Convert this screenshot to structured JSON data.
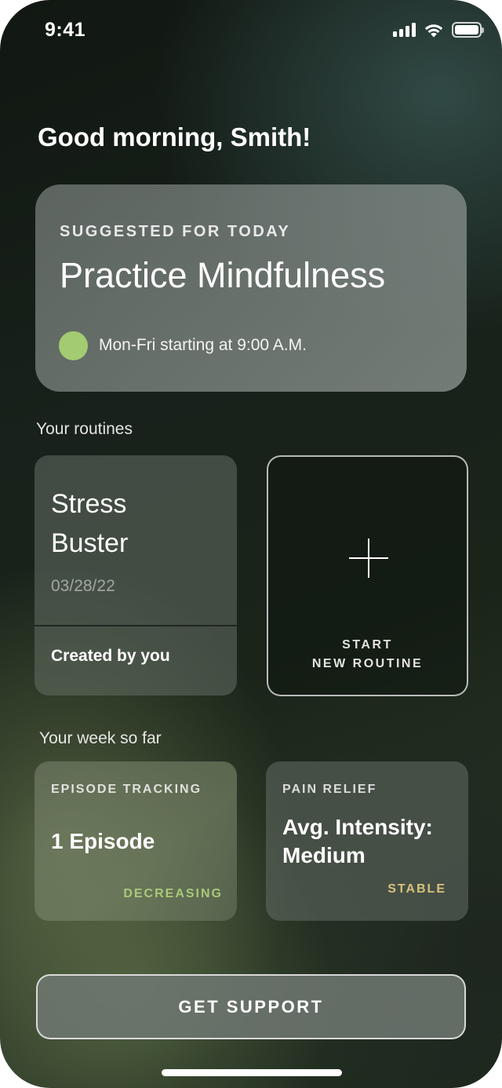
{
  "status_bar": {
    "time": "9:41",
    "icons": [
      "cellular-signal-icon",
      "wifi-icon",
      "battery-icon"
    ]
  },
  "greeting": "Good morning, Smith!",
  "suggested": {
    "eyebrow": "SUGGESTED FOR TODAY",
    "title": "Practice Mindfulness",
    "schedule": "Mon-Fri starting at 9:00 A.M.",
    "dot_color": "#a3cc72"
  },
  "routines": {
    "label": "Your routines",
    "items": [
      {
        "name": "Stress Buster",
        "date": "03/28/22",
        "footer": "Created by you"
      }
    ],
    "new_routine": {
      "label": "START\nNEW ROUTINE",
      "icon": "plus-icon"
    }
  },
  "week": {
    "label": "Your week so far",
    "cards": [
      {
        "eyebrow": "EPISODE TRACKING",
        "value": "1 Episode",
        "trend": "DECREASING",
        "trend_color": "#a9c97a"
      },
      {
        "eyebrow": "PAIN RELIEF",
        "value": "Avg. Intensity: Medium",
        "trend": "STABLE",
        "trend_color": "#d8c27a"
      }
    ]
  },
  "support_button": "GET SUPPORT",
  "colors": {
    "accent_green": "#a3cc72",
    "background": "#18211b"
  }
}
